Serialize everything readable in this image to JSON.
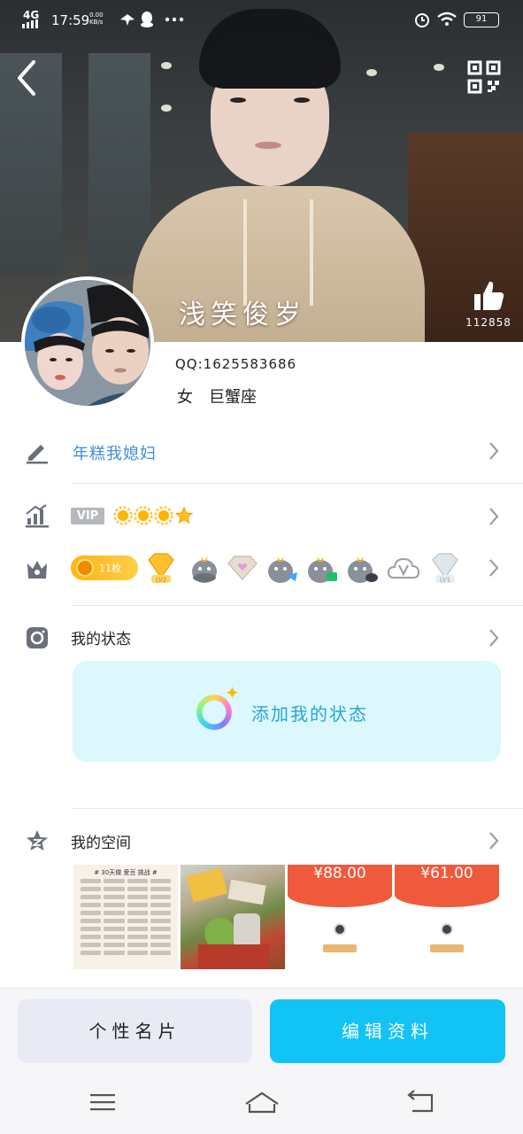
{
  "status_bar": {
    "network": "4G",
    "time": "17:59",
    "speed_value": "0.00",
    "speed_unit": "KB/s",
    "battery": "91"
  },
  "profile": {
    "nickname": "浅笑俊岁",
    "like_count": "112858",
    "qq_number": "QQ:1625583686",
    "gender": "女",
    "zodiac": "巨蟹座",
    "signature": "年糕我媳妇"
  },
  "privileges": {
    "vip_label": "VIP",
    "coin_label": "11枚"
  },
  "status_section": {
    "title": "我的状态",
    "add_label": "添加我的状态"
  },
  "space_section": {
    "title": "我的空间",
    "calendar_title": "# 30天做 爱豆 挑战 #",
    "red_packet_1": "¥88.00",
    "red_packet_2": "¥61.00"
  },
  "buttons": {
    "card": "个性名片",
    "edit": "编辑资料"
  },
  "colors": {
    "accent": "#12c3f5",
    "signature": "#3f8ed8",
    "status_card": "#dcf8fc",
    "red_packet": "#f05a3c"
  }
}
